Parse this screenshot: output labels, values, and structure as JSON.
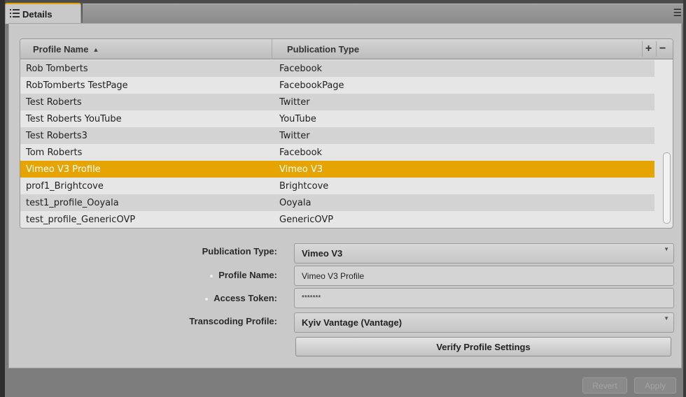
{
  "tab": {
    "label": "Details",
    "icon": "list-icon",
    "menu_icon": "panel-menu-icon"
  },
  "table": {
    "columns": [
      {
        "label": "Profile Name",
        "sort": "ascending"
      },
      {
        "label": "Publication Type"
      }
    ],
    "add_label": "+",
    "remove_label": "−",
    "rows": [
      {
        "name": "Rob Tomberts",
        "type": "Facebook"
      },
      {
        "name": "RobTomberts TestPage",
        "type": "FacebookPage"
      },
      {
        "name": "Test Roberts",
        "type": "Twitter"
      },
      {
        "name": "Test Roberts YouTube",
        "type": "YouTube"
      },
      {
        "name": "Test Roberts3",
        "type": "Twitter"
      },
      {
        "name": "Tom Roberts",
        "type": "Facebook"
      },
      {
        "name": "Vimeo V3 Profile",
        "type": "Vimeo V3",
        "selected": true
      },
      {
        "name": "prof1_Brightcove",
        "type": "Brightcove"
      },
      {
        "name": "test1_profile_Ooyala",
        "type": "Ooyala"
      },
      {
        "name": "test_profile_GenericOVP",
        "type": "GenericOVP"
      }
    ]
  },
  "form": {
    "publication_type": {
      "label": "Publication Type:",
      "value": "Vimeo V3"
    },
    "profile_name": {
      "label": "Profile Name:",
      "value": "Vimeo V3 Profile"
    },
    "access_token": {
      "label": "Access Token:",
      "value": "*******"
    },
    "transcoding_profile": {
      "label": "Transcoding Profile:",
      "value": "Kyiv Vantage (Vantage)"
    },
    "verify_label": "Verify Profile Settings"
  },
  "footer": {
    "revert_label": "Revert",
    "apply_label": "Apply"
  },
  "colors": {
    "selection": "#e6a400",
    "panel": "#c9c9c9",
    "frame": "#7d7d7d"
  }
}
